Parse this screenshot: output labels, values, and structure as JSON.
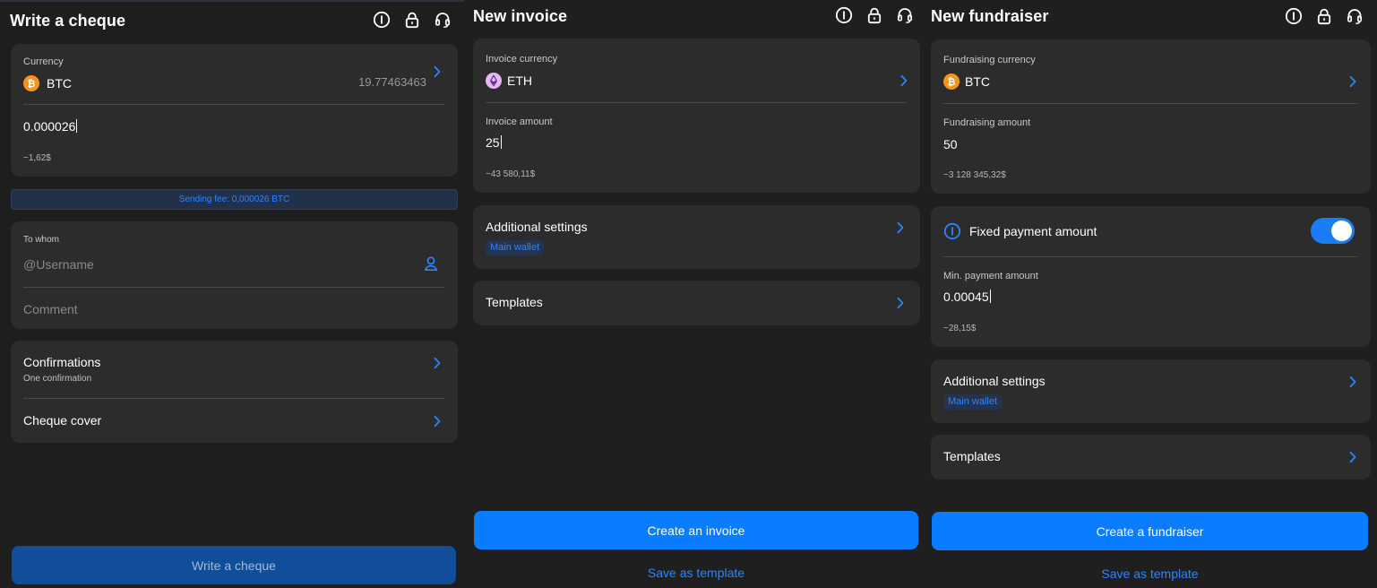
{
  "cheque": {
    "title": "Write a cheque",
    "currency_label": "Currency",
    "currency": "BTC",
    "balance": "19.77463463",
    "amount": "0.000026",
    "amount_fiat": "~1,62$",
    "fee_text": "Sending fee: 0,000026 BTC",
    "to_whom_label": "To whom",
    "username_placeholder": "@Username",
    "comment_placeholder": "Comment",
    "confirmations_title": "Confirmations",
    "confirmations_sub": "One confirmation",
    "cover_title": "Cheque cover",
    "submit_label": "Write a cheque"
  },
  "invoice": {
    "title": "New invoice",
    "currency_label": "Invoice currency",
    "currency": "ETH",
    "amount_label": "Invoice amount",
    "amount": "25",
    "amount_fiat": "~43 580,11$",
    "additional_title": "Additional settings",
    "wallet_tag": "Main wallet",
    "templates_title": "Templates",
    "create_label": "Create an invoice",
    "save_label": "Save as template"
  },
  "fundraiser": {
    "title": "New fundraiser",
    "currency_label": "Fundraising currency",
    "currency": "BTC",
    "amount_label": "Fundraising amount",
    "amount": "50",
    "amount_fiat": "~3 128 345,32$",
    "fixed_label": "Fixed payment amount",
    "fixed_enabled": true,
    "min_label": "Min. payment amount",
    "min_amount": "0.00045",
    "min_fiat": "~28,15$",
    "additional_title": "Additional settings",
    "wallet_tag": "Main wallet",
    "templates_title": "Templates",
    "create_label": "Create a fundraiser",
    "save_label": "Save as template"
  },
  "colors": {
    "accent": "#0a7cff",
    "btc": "#f7931a",
    "eth": "#e7b6f5",
    "card": "#2c2c2c",
    "background": "#1f1f1f"
  }
}
